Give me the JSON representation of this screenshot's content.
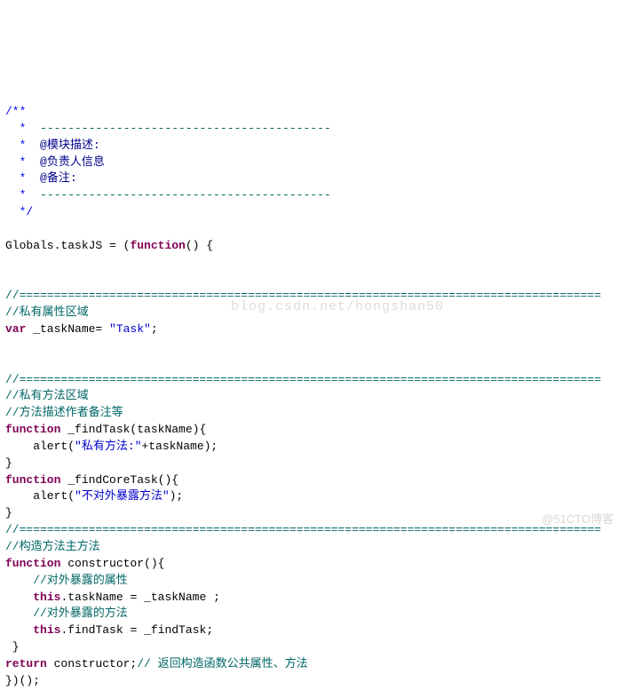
{
  "lines": {
    "l1": "/**",
    "l2a": "  *  ",
    "l2b": "------------------------------------------",
    "l3a": "  *  ",
    "l3b": "@模块描述:",
    "l4a": "  *  ",
    "l4b": "@负责人信息",
    "l5a": "  *  ",
    "l5b": "@备注:",
    "l6a": "  *  ",
    "l6b": "------------------------------------------",
    "l7": "  */",
    "l8a": "Globals.taskJS = (",
    "l8b": "function",
    "l8c": "() {",
    "sep": "//====================================================================================",
    "c1": "//私有属性区域",
    "v1a": "var",
    "v1b": " _taskName= ",
    "v1c": "\"Task\"",
    "v1d": ";",
    "c2": "//私有方法区域",
    "c3": "//方法描述作者备注等",
    "f1a": "function",
    "f1b": " _findTask(taskName){",
    "al1a": "    alert(",
    "al1b": "\"私有方法:\"",
    "al1c": "+taskName);",
    "cb": "}",
    "f2a": "function",
    "f2b": " _findCoreTask(){",
    "al2a": "    alert(",
    "al2b": "\"不对外暴露方法\"",
    "al2c": ");",
    "c4": "//构造方法主方法",
    "f3a": "function",
    "f3b": " constructor(){",
    "c5": "    //对外暴露的属性",
    "t1a": "    ",
    "t1b": "this",
    "t1c": ".taskName = _taskName ;",
    "c6": "    //对外暴露的方法",
    "t2a": "    ",
    "t2b": "this",
    "t2c": ".findTask = _findTask;",
    "cb2": " }",
    "r1a": "return",
    "r1b": " constructor;",
    "r1c": "// 返回构造函数公共属性、方法",
    "end": "})();"
  },
  "watermarks": {
    "w1": "blog.csdn.net/hongshan50",
    "w2": "@51CTO博客"
  }
}
